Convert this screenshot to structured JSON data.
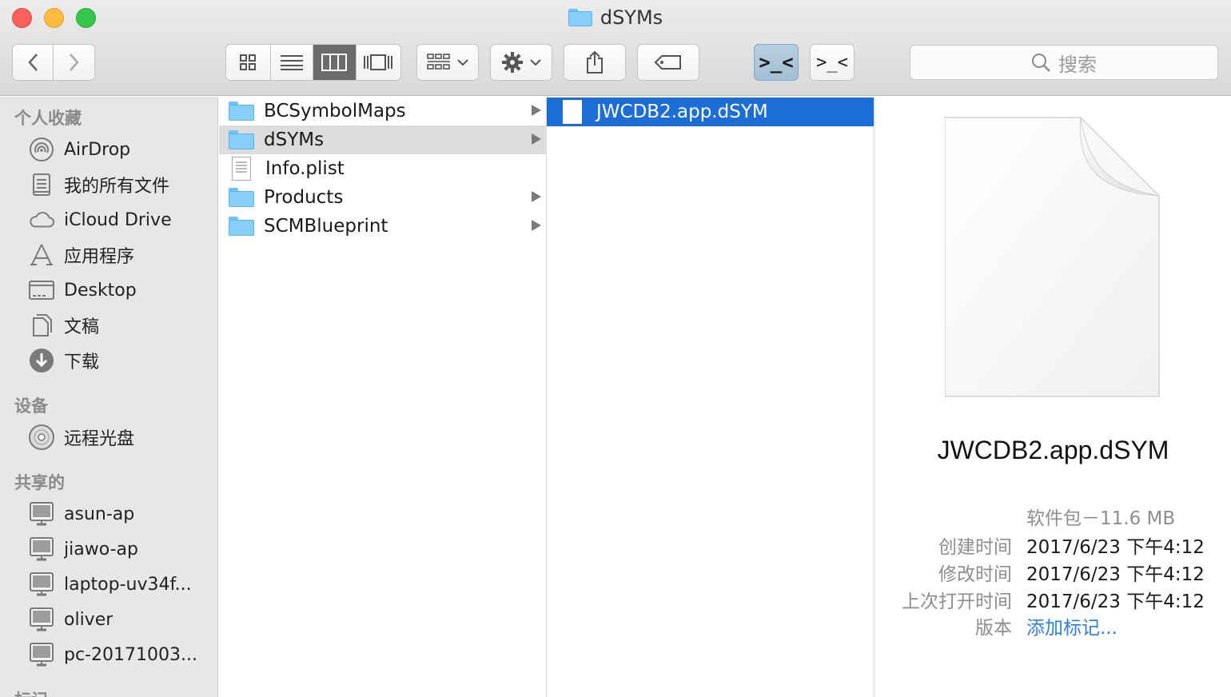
{
  "window": {
    "title": "dSYMs"
  },
  "toolbar": {
    "back_icon": "chevron-left-icon",
    "forward_icon": "chevron-right-icon",
    "view_modes": [
      "icon-view",
      "list-view",
      "column-view",
      "cover-flow-view"
    ],
    "active_view": "column-view",
    "terminal_btn_1": ">_<",
    "terminal_btn_2": ">_<",
    "search_placeholder": "搜索"
  },
  "sidebar": {
    "sections": [
      {
        "title": "个人收藏",
        "items": [
          {
            "label": "AirDrop",
            "icon": "airdrop-icon"
          },
          {
            "label": "我的所有文件",
            "icon": "all-files-icon"
          },
          {
            "label": "iCloud Drive",
            "icon": "cloud-icon"
          },
          {
            "label": "应用程序",
            "icon": "applications-icon"
          },
          {
            "label": "Desktop",
            "icon": "desktop-icon"
          },
          {
            "label": "文稿",
            "icon": "documents-icon"
          },
          {
            "label": "下载",
            "icon": "download-icon"
          }
        ]
      },
      {
        "title": "设备",
        "items": [
          {
            "label": "远程光盘",
            "icon": "disc-icon"
          }
        ]
      },
      {
        "title": "共享的",
        "items": [
          {
            "label": "asun-ap",
            "icon": "computer-icon"
          },
          {
            "label": "jiawo-ap",
            "icon": "computer-icon"
          },
          {
            "label": "laptop-uv34f...",
            "icon": "computer-icon"
          },
          {
            "label": "oliver",
            "icon": "computer-icon"
          },
          {
            "label": "pc-20171003...",
            "icon": "computer-icon"
          }
        ]
      },
      {
        "title": "标记",
        "items": []
      }
    ]
  },
  "column1": {
    "items": [
      {
        "name": "BCSymbolMaps",
        "type": "folder",
        "has_children": true,
        "selected": false
      },
      {
        "name": "dSYMs",
        "type": "folder",
        "has_children": true,
        "selected": true
      },
      {
        "name": "Info.plist",
        "type": "plist",
        "has_children": false,
        "selected": false
      },
      {
        "name": "Products",
        "type": "folder",
        "has_children": true,
        "selected": false
      },
      {
        "name": "SCMBlueprint",
        "type": "folder",
        "has_children": true,
        "selected": false
      }
    ]
  },
  "column2": {
    "items": [
      {
        "name": "JWCDB2.app.dSYM",
        "type": "package",
        "selected": true
      }
    ]
  },
  "preview": {
    "name": "JWCDB2.app.dSYM",
    "kind_size": "软件包－11.6 MB",
    "created_label": "创建时间",
    "created_value": "2017/6/23 下午4:12",
    "modified_label": "修改时间",
    "modified_value": "2017/6/23 下午4:12",
    "opened_label": "上次打开时间",
    "opened_value": "2017/6/23 下午4:12",
    "version_label": "版本",
    "version_value": "添加标记..."
  }
}
